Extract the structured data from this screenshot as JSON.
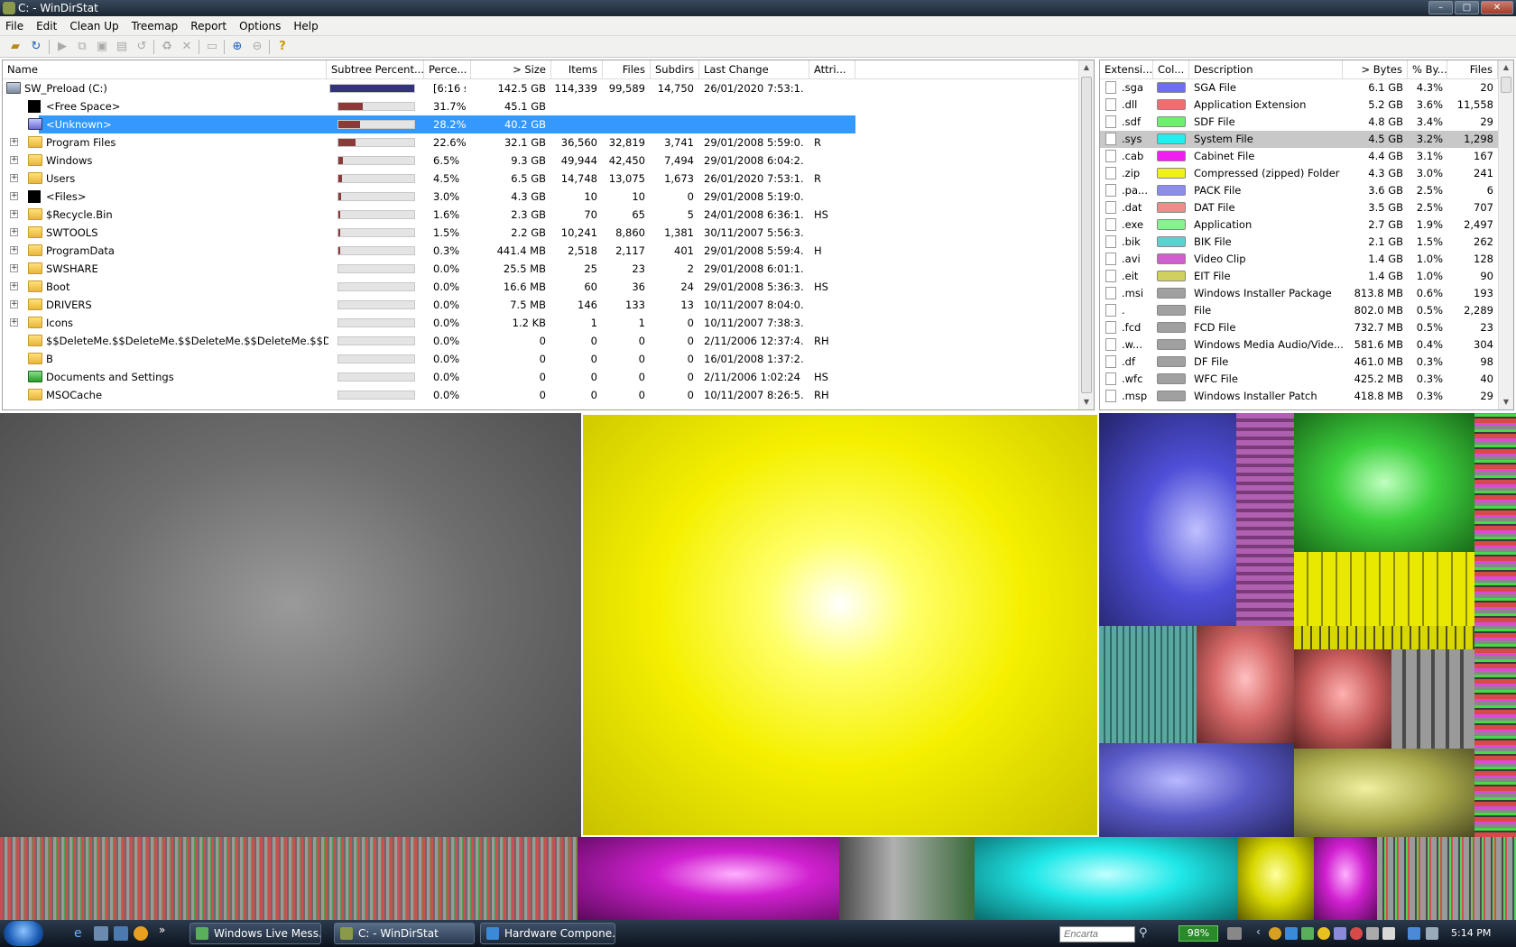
{
  "window": {
    "title": "C: - WinDirStat",
    "buttons": [
      "–",
      "□",
      "✕"
    ]
  },
  "menu": [
    "File",
    "Edit",
    "Clean Up",
    "Treemap",
    "Report",
    "Options",
    "Help"
  ],
  "tree": {
    "columns": [
      "Name",
      "Subtree Percent...",
      "Perce...",
      "> Size",
      "Items",
      "Files",
      "Subdirs",
      "Last Change",
      "Attri..."
    ],
    "rows": [
      {
        "name": "SW_Preload (C:)",
        "sub": "",
        "pct": "[6:16 s]",
        "size": "142.5 GB",
        "items": "114,339",
        "files": "99,589",
        "subdirs": "14,750",
        "last": "26/01/2020 7:53:1...",
        "attr": "",
        "fill": 1.0,
        "icon": "drive",
        "expand": false,
        "indent": 0
      },
      {
        "name": "<Free Space>",
        "pct": "31.7%",
        "size": "45.1 GB",
        "items": "",
        "files": "",
        "subdirs": "",
        "last": "",
        "attr": "",
        "fill": 0.317,
        "icon": "black",
        "expand": false,
        "indent": 1
      },
      {
        "name": "<Unknown>",
        "pct": "28.2%",
        "size": "40.2 GB",
        "items": "",
        "files": "",
        "subdirs": "",
        "last": "",
        "attr": "",
        "fill": 0.282,
        "icon": "unknown",
        "expand": false,
        "indent": 1,
        "selected": true
      },
      {
        "name": "Program Files",
        "pct": "22.6%",
        "size": "32.1 GB",
        "items": "36,560",
        "files": "32,819",
        "subdirs": "3,741",
        "last": "29/01/2008 5:59:0...",
        "attr": "R",
        "fill": 0.226,
        "icon": "folder",
        "expand": true,
        "indent": 1
      },
      {
        "name": "Windows",
        "pct": "6.5%",
        "size": "9.3 GB",
        "items": "49,944",
        "files": "42,450",
        "subdirs": "7,494",
        "last": "29/01/2008 6:04:2...",
        "attr": "",
        "fill": 0.065,
        "icon": "folder",
        "expand": true,
        "indent": 1
      },
      {
        "name": "Users",
        "pct": "4.5%",
        "size": "6.5 GB",
        "items": "14,748",
        "files": "13,075",
        "subdirs": "1,673",
        "last": "26/01/2020 7:53:1...",
        "attr": "R",
        "fill": 0.045,
        "icon": "folder",
        "expand": true,
        "indent": 1
      },
      {
        "name": "<Files>",
        "pct": "3.0%",
        "size": "4.3 GB",
        "items": "10",
        "files": "10",
        "subdirs": "0",
        "last": "29/01/2008 5:19:0...",
        "attr": "",
        "fill": 0.03,
        "icon": "black",
        "expand": true,
        "indent": 1
      },
      {
        "name": "$Recycle.Bin",
        "pct": "1.6%",
        "size": "2.3 GB",
        "items": "70",
        "files": "65",
        "subdirs": "5",
        "last": "24/01/2008 6:36:1...",
        "attr": "HS",
        "fill": 0.016,
        "icon": "folder",
        "expand": true,
        "indent": 1
      },
      {
        "name": "SWTOOLS",
        "pct": "1.5%",
        "size": "2.2 GB",
        "items": "10,241",
        "files": "8,860",
        "subdirs": "1,381",
        "last": "30/11/2007 5:56:3...",
        "attr": "",
        "fill": 0.015,
        "icon": "folder",
        "expand": true,
        "indent": 1
      },
      {
        "name": "ProgramData",
        "pct": "0.3%",
        "size": "441.4 MB",
        "items": "2,518",
        "files": "2,117",
        "subdirs": "401",
        "last": "29/01/2008 5:59:4...",
        "attr": "H",
        "fill": 0.003,
        "icon": "folder",
        "expand": true,
        "indent": 1
      },
      {
        "name": "SWSHARE",
        "pct": "0.0%",
        "size": "25.5 MB",
        "items": "25",
        "files": "23",
        "subdirs": "2",
        "last": "29/01/2008 6:01:1...",
        "attr": "",
        "fill": 0.0,
        "icon": "folder",
        "expand": true,
        "indent": 1
      },
      {
        "name": "Boot",
        "pct": "0.0%",
        "size": "16.6 MB",
        "items": "60",
        "files": "36",
        "subdirs": "24",
        "last": "29/01/2008 5:36:3...",
        "attr": "HS",
        "fill": 0.0,
        "icon": "folder",
        "expand": true,
        "indent": 1
      },
      {
        "name": "DRIVERS",
        "pct": "0.0%",
        "size": "7.5 MB",
        "items": "146",
        "files": "133",
        "subdirs": "13",
        "last": "10/11/2007 8:04:0...",
        "attr": "",
        "fill": 0.0,
        "icon": "folder",
        "expand": true,
        "indent": 1
      },
      {
        "name": "Icons",
        "pct": "0.0%",
        "size": "1.2 KB",
        "items": "1",
        "files": "1",
        "subdirs": "0",
        "last": "10/11/2007 7:38:3...",
        "attr": "",
        "fill": 0.0,
        "icon": "folder",
        "expand": true,
        "indent": 1
      },
      {
        "name": "$$DeleteMe.$$DeleteMe.$$DeleteMe.$$DeleteMe.$$Dele...",
        "pct": "0.0%",
        "size": "0",
        "items": "0",
        "files": "0",
        "subdirs": "0",
        "last": "2/11/2006 12:37:4...",
        "attr": "RH",
        "fill": 0.0,
        "icon": "folder",
        "expand": false,
        "indent": 1
      },
      {
        "name": "B",
        "pct": "0.0%",
        "size": "0",
        "items": "0",
        "files": "0",
        "subdirs": "0",
        "last": "16/01/2008 1:37:2...",
        "attr": "",
        "fill": 0.0,
        "icon": "folder",
        "expand": false,
        "indent": 1
      },
      {
        "name": "Documents and Settings",
        "pct": "0.0%",
        "size": "0",
        "items": "0",
        "files": "0",
        "subdirs": "0",
        "last": "2/11/2006 1:02:24 ...",
        "attr": "HS",
        "fill": 0.0,
        "icon": "green",
        "expand": false,
        "indent": 1
      },
      {
        "name": "MSOCache",
        "pct": "0.0%",
        "size": "0",
        "items": "0",
        "files": "0",
        "subdirs": "0",
        "last": "10/11/2007 8:26:5...",
        "attr": "RH",
        "fill": 0.0,
        "icon": "folder",
        "expand": false,
        "indent": 1
      }
    ]
  },
  "ext": {
    "columns": [
      "Extensi...",
      "Col...",
      "Description",
      "> Bytes",
      "% By...",
      "Files"
    ],
    "rows": [
      {
        "ext": ".sga",
        "color": "#6e6ef5",
        "desc": "SGA File",
        "bytes": "6.1 GB",
        "pct": "4.3%",
        "files": "20"
      },
      {
        "ext": ".dll",
        "color": "#f06e6e",
        "desc": "Application Extension",
        "bytes": "5.2 GB",
        "pct": "3.6%",
        "files": "11,558"
      },
      {
        "ext": ".sdf",
        "color": "#6ef06e",
        "desc": "SDF File",
        "bytes": "4.8 GB",
        "pct": "3.4%",
        "files": "29"
      },
      {
        "ext": ".sys",
        "color": "#1ef0f0",
        "desc": "System File",
        "bytes": "4.5 GB",
        "pct": "3.2%",
        "files": "1,298",
        "selected": true
      },
      {
        "ext": ".cab",
        "color": "#f01ef0",
        "desc": "Cabinet File",
        "bytes": "4.4 GB",
        "pct": "3.1%",
        "files": "167"
      },
      {
        "ext": ".zip",
        "color": "#f0f01e",
        "desc": "Compressed (zipped) Folder",
        "bytes": "4.3 GB",
        "pct": "3.0%",
        "files": "241"
      },
      {
        "ext": ".pa...",
        "color": "#8c8cf0",
        "desc": "PACK File",
        "bytes": "3.6 GB",
        "pct": "2.5%",
        "files": "6"
      },
      {
        "ext": ".dat",
        "color": "#f08c8c",
        "desc": "DAT File",
        "bytes": "3.5 GB",
        "pct": "2.5%",
        "files": "707"
      },
      {
        "ext": ".exe",
        "color": "#8cf08c",
        "desc": "Application",
        "bytes": "2.7 GB",
        "pct": "1.9%",
        "files": "2,497"
      },
      {
        "ext": ".bik",
        "color": "#5ed0d0",
        "desc": "BIK File",
        "bytes": "2.1 GB",
        "pct": "1.5%",
        "files": "262"
      },
      {
        "ext": ".avi",
        "color": "#d05ed0",
        "desc": "Video Clip",
        "bytes": "1.4 GB",
        "pct": "1.0%",
        "files": "128"
      },
      {
        "ext": ".eit",
        "color": "#d0d05e",
        "desc": "EIT File",
        "bytes": "1.4 GB",
        "pct": "1.0%",
        "files": "90"
      },
      {
        "ext": ".msi",
        "color": "#a0a0a0",
        "desc": "Windows Installer Package",
        "bytes": "813.8 MB",
        "pct": "0.6%",
        "files": "193"
      },
      {
        "ext": ".",
        "color": "#a0a0a0",
        "desc": "File",
        "bytes": "802.0 MB",
        "pct": "0.5%",
        "files": "2,289"
      },
      {
        "ext": ".fcd",
        "color": "#a0a0a0",
        "desc": "FCD File",
        "bytes": "732.7 MB",
        "pct": "0.5%",
        "files": "23"
      },
      {
        "ext": ".w...",
        "color": "#a0a0a0",
        "desc": "Windows Media Audio/Vide...",
        "bytes": "581.6 MB",
        "pct": "0.4%",
        "files": "304"
      },
      {
        "ext": ".df",
        "color": "#a0a0a0",
        "desc": "DF File",
        "bytes": "461.0 MB",
        "pct": "0.3%",
        "files": "98"
      },
      {
        "ext": ".wfc",
        "color": "#a0a0a0",
        "desc": "WFC File",
        "bytes": "425.2 MB",
        "pct": "0.3%",
        "files": "40"
      },
      {
        "ext": ".msp",
        "color": "#a0a0a0",
        "desc": "Windows Installer Patch",
        "bytes": "418.8 MB",
        "pct": "0.3%",
        "files": "29"
      }
    ]
  },
  "taskbar": {
    "tasks": [
      {
        "label": "Windows Live Mess..."
      },
      {
        "label": "C: - WinDirStat"
      },
      {
        "label": "Hardware Compone..."
      }
    ],
    "search_placeholder": "Encarta",
    "battery": "98%",
    "clock": "5:14 PM"
  }
}
